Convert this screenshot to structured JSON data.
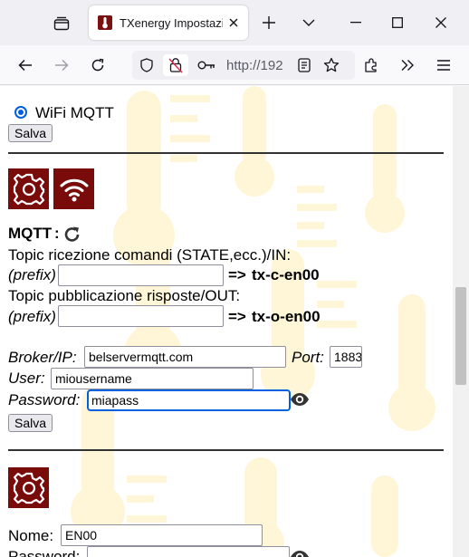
{
  "browser": {
    "tab_title": "TXenergy Impostazio",
    "url": "http://192"
  },
  "page": {
    "radio_wifi_mqtt": "WiFi MQTT",
    "save_button_1": "Salva",
    "mqtt_heading": "MQTT",
    "mqtt_colon": ":",
    "topic_in_label": "Topic ricezione comandi (STATE,ecc.)/IN:",
    "prefix_label": "(prefix)",
    "topic_in_value": "",
    "topic_in_suffix_arrow": "=>",
    "topic_in_suffix": "tx-c-en00",
    "topic_out_label": "Topic pubblicazione risposte/OUT:",
    "topic_out_value": "",
    "topic_out_suffix_arrow": "=>",
    "topic_out_suffix": "tx-o-en00",
    "broker_label": "Broker/IP:",
    "broker_value": "belservermqtt.com",
    "port_label": "Port:",
    "port_value": "1883",
    "user_label": "User:",
    "user_value": "miousername",
    "password_label": "Password:",
    "password_value": "miapass",
    "save_button_2": "Salva",
    "name_label": "Nome:",
    "name_value": "EN00",
    "password2_label": "Password:"
  },
  "colors": {
    "brand": "#7a0b0b",
    "watermark": "#fff4cc",
    "focus": "#0061e0"
  }
}
